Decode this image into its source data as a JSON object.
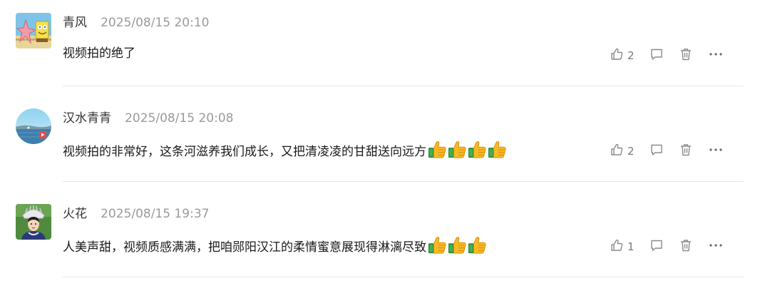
{
  "comments": [
    {
      "user": "青风",
      "time": "2025/08/15 20:10",
      "text": "视频拍的绝了",
      "likes": "2",
      "emoji_count": 0
    },
    {
      "user": "汉水青青",
      "time": "2025/08/15 20:08",
      "text": "视频拍的非常好，这条河滋养我们成长，又把清凌凌的甘甜送向远方",
      "likes": "2",
      "emoji_count": 4
    },
    {
      "user": "火花",
      "time": "2025/08/15 19:37",
      "text": "人美声甜，视频质感满满，把咱郧阳汉江的柔情蜜意展现得淋漓尽致",
      "likes": "1",
      "emoji_count": 3
    }
  ],
  "icons": {
    "like": "thumbs-up-outline-icon",
    "reply": "comment-bubble-icon",
    "delete": "trash-icon",
    "more": "ellipsis-icon",
    "emoji": "thumbs-up-emoji-icon"
  },
  "colors": {
    "text_primary": "#1a1a1a",
    "text_secondary": "#9a9a9a",
    "icon": "#8a8a8a",
    "divider": "#e6e6e6"
  }
}
